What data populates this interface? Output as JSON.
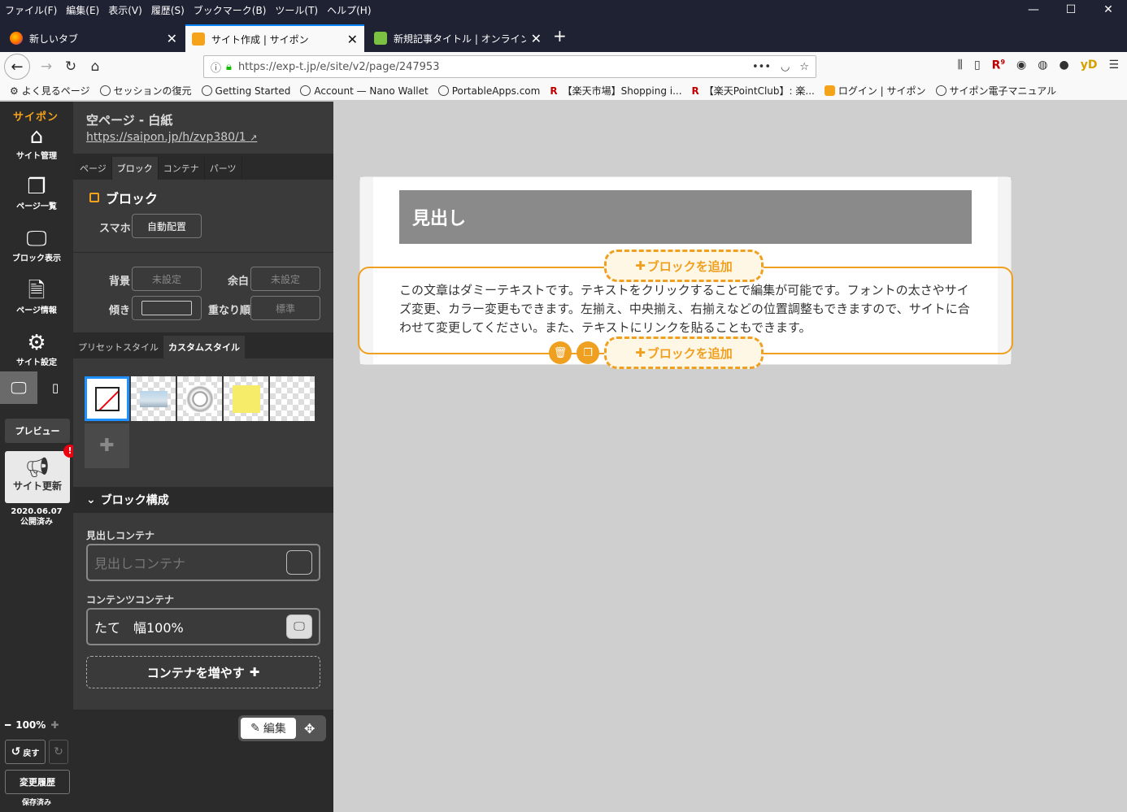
{
  "menubar": {
    "items": [
      "ファイル(F)",
      "編集(E)",
      "表示(V)",
      "履歴(S)",
      "ブックマーク(B)",
      "ツール(T)",
      "ヘルプ(H)"
    ],
    "minimize": "—",
    "maximize": "☐",
    "close": "✕"
  },
  "tabs": [
    {
      "title": "新しいタブ",
      "icon": "firefox-icon"
    },
    {
      "title": "サイト作成 | サイポン",
      "icon": "saipon-icon"
    },
    {
      "title": "新規記事タイトル | オンラインUP副",
      "icon": "leaf-icon"
    }
  ],
  "navbar": {
    "url": "https://exp-t.jp/e/site/v2/page/247953",
    "page_actions": "•••",
    "rakuten_badge": "9",
    "yd": "yD"
  },
  "bookmarks": [
    {
      "label": "よく見るページ",
      "icon": "gear-icon"
    },
    {
      "label": "セッションの復元",
      "icon": "globe-icon"
    },
    {
      "label": "Getting Started",
      "icon": "globe-icon"
    },
    {
      "label": "Account — Nano Wallet",
      "icon": "globe-icon"
    },
    {
      "label": "PortableApps.com",
      "icon": "globe-icon"
    },
    {
      "label": "【楽天市場】Shopping i...",
      "icon": "rakuten-icon"
    },
    {
      "label": "【楽天PointClub】: 楽...",
      "icon": "rakuten-icon"
    },
    {
      "label": "ログイン | サイポン",
      "icon": "saipon-icon"
    },
    {
      "label": "サイポン電子マニュアル",
      "icon": "globe-icon"
    }
  ],
  "rail": {
    "logo": "サイポン",
    "items": [
      {
        "label": "サイト管理",
        "icon": "home-icon"
      },
      {
        "label": "ページ一覧",
        "icon": "pages-icon"
      },
      {
        "label": "ブロック表示",
        "icon": "monitor-icon"
      },
      {
        "label": "ページ情報",
        "icon": "document-icon"
      },
      {
        "label": "サイト設定",
        "icon": "gear-icon"
      }
    ],
    "preview": "プレビュー",
    "update": "サイト更新",
    "update_badge": "!",
    "pub_date": "2020.06.07",
    "pub_status": "公開済み",
    "zoom": "100%",
    "undo": "戻す",
    "history": "変更履歴",
    "saved": "保存済み"
  },
  "panel": {
    "title": "空ページ - 白紙",
    "url": "https://saipon.jp/h/zvp380/1",
    "tabs": [
      "ページ",
      "ブロック",
      "コンテナ",
      "パーツ"
    ],
    "active_tab": "ブロック",
    "block_heading": "ブロック",
    "smartphone_label": "スマホ",
    "smartphone_value": "自動配置",
    "bg_label": "背景",
    "bg_value": "未設定",
    "margin_label": "余白",
    "margin_value": "未設定",
    "tilt_label": "傾き",
    "order_label": "重なり順",
    "order_value": "標準",
    "style_tabs": [
      "プリセットスタイル",
      "カスタムスタイル"
    ],
    "composition_heading": "ブロック構成",
    "heading_container_label": "見出しコンテナ",
    "heading_container_placeholder": "見出しコンテナ",
    "contents_container_label": "コンテンツコンテナ",
    "contents_container_value": "たて　幅100%",
    "add_container": "コンテナを増やす",
    "edit": "編集"
  },
  "canvas": {
    "heading": "見出し",
    "body": "この文章はダミーテキストです。テキストをクリックすることで編集が可能です。フォントの太さやサイズ変更、カラー変更もできます。左揃え、中央揃え、右揃えなどの位置調整もできますので、サイトに合わせて変更してください。また、テキストにリンクを貼ることもできます。",
    "add_block": "ブロックを追加"
  },
  "colors": {
    "accent": "#f0a020",
    "rail_bg": "#2b2b2b",
    "panel_bg": "#3a3a3a",
    "heading_bg": "#8a8a8a"
  }
}
